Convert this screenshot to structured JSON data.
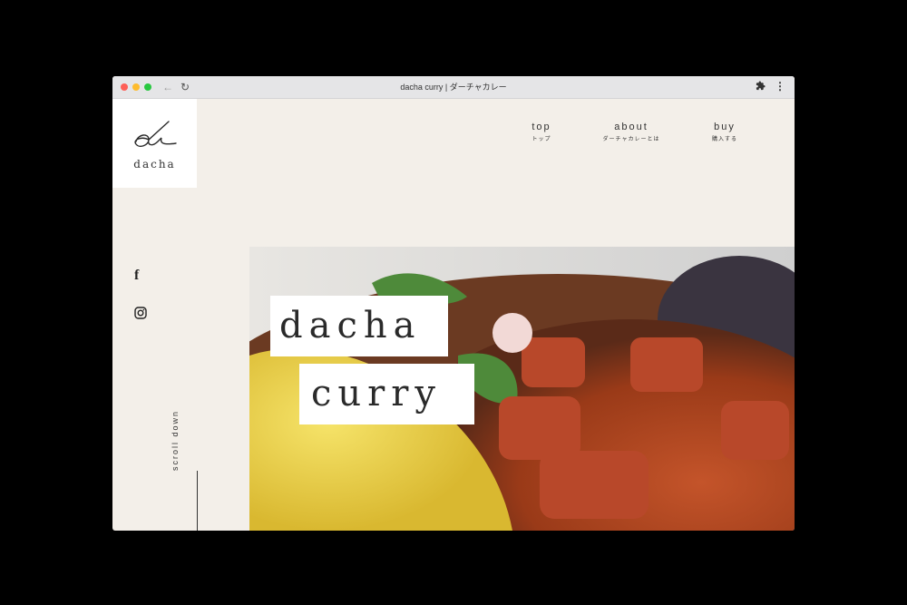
{
  "browser": {
    "tab_title": "dacha curry | ダーチャカレー",
    "back_icon": "←",
    "reload_icon": "↻",
    "extensions_icon": "puzzle-icon",
    "menu_icon": "⋮"
  },
  "logo": {
    "text": "dacha"
  },
  "nav": [
    {
      "en": "top",
      "jp": "トップ"
    },
    {
      "en": "about",
      "jp": "ダーチャカレーとは"
    },
    {
      "en": "buy",
      "jp": "購入する"
    }
  ],
  "social": {
    "facebook_icon": "f",
    "instagram_icon": "instagram-icon"
  },
  "scroll": {
    "label": "scroll down"
  },
  "hero": {
    "line1": "dacha",
    "line2": "curry"
  },
  "colors": {
    "background": "#f3efe9",
    "text": "#2a2a2a",
    "title_box": "#ffffff"
  }
}
